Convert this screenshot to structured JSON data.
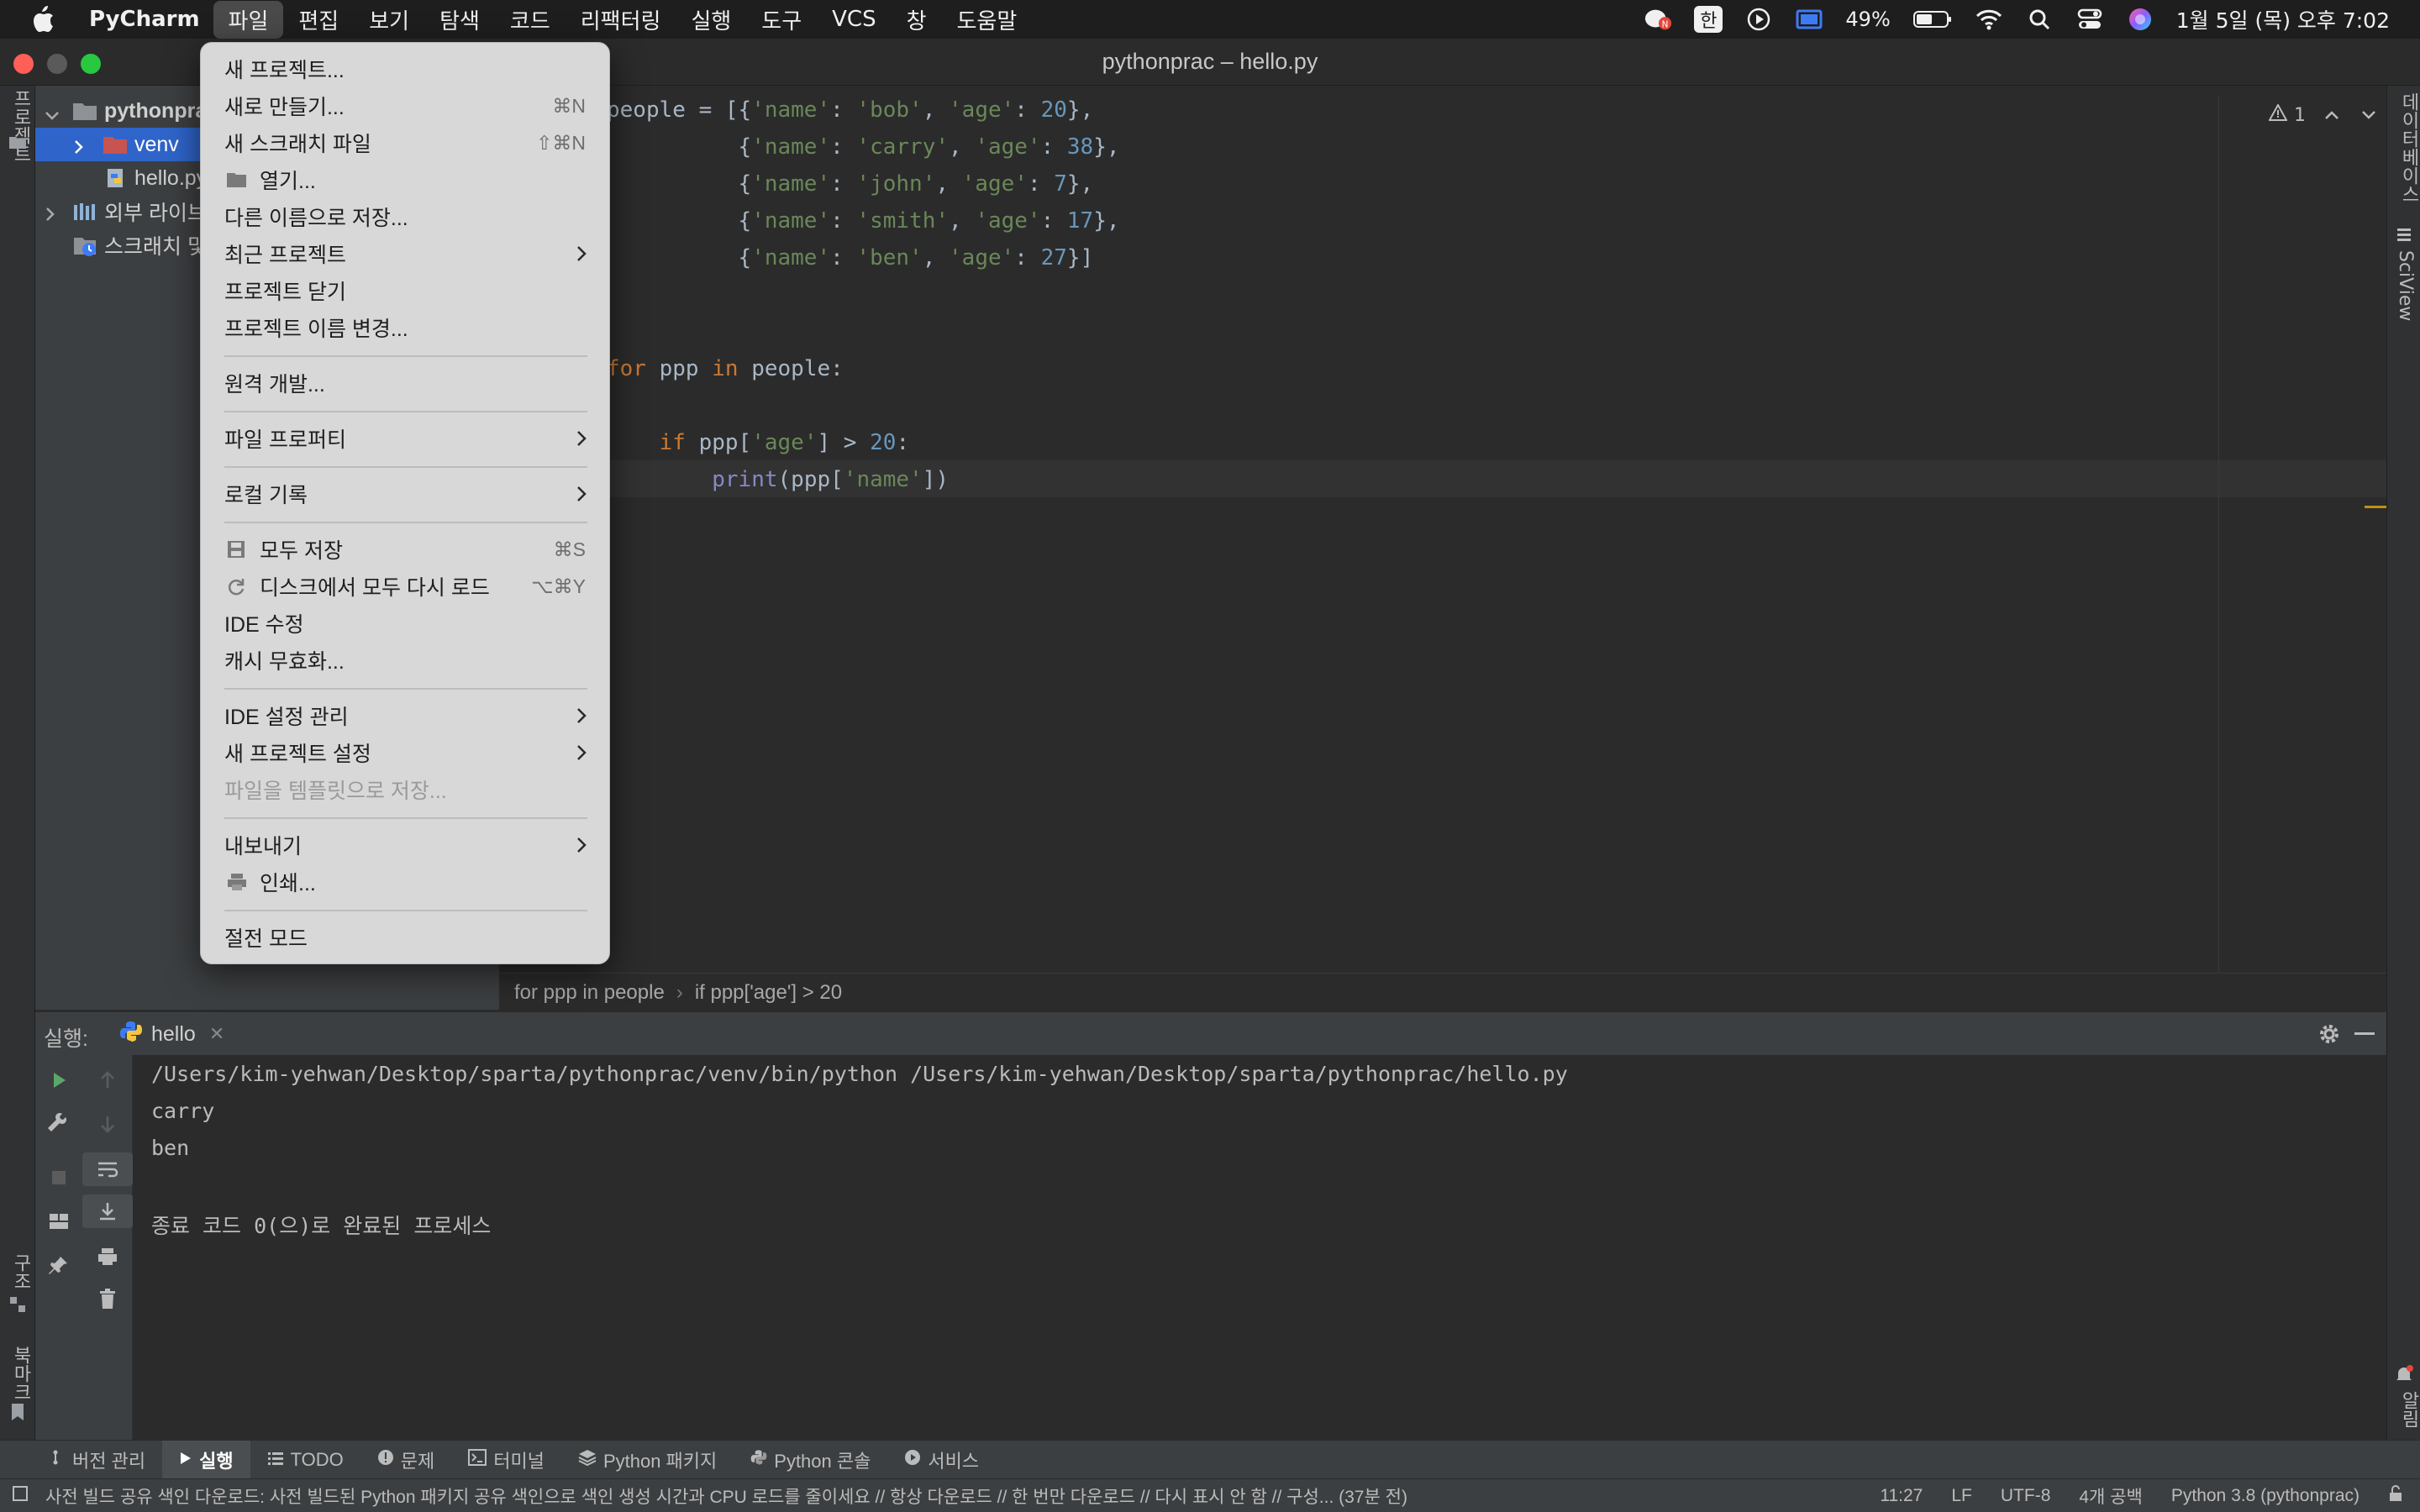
{
  "menubar": {
    "app_name": "PyCharm",
    "items": [
      "파일",
      "편집",
      "보기",
      "탐색",
      "코드",
      "리팩터링",
      "실행",
      "도구",
      "VCS",
      "창",
      "도움말"
    ],
    "active_item": "파일",
    "input_method": "한",
    "battery": "49%",
    "datetime": "1월 5일 (목) 오후 7:02"
  },
  "window": {
    "title": "pythonprac – hello.py"
  },
  "left_strip": {
    "project_label": "프로젝트",
    "structure_label": "구조",
    "bookmarks_label": "북마크"
  },
  "right_strip": {
    "database_label": "데이터베이스",
    "sciview_label": "SciView",
    "notifications_label": "알림"
  },
  "project_tree": {
    "items": [
      {
        "label": "pythonprac",
        "kind": "project-root"
      },
      {
        "label": "venv",
        "kind": "folder",
        "selected": true
      },
      {
        "label": "hello.py",
        "kind": "file"
      },
      {
        "label": "외부 라이브러리",
        "kind": "libraries"
      },
      {
        "label": "스크래치 및 콘솔",
        "kind": "scratches"
      }
    ]
  },
  "editor": {
    "warnings_count": "1",
    "lines": [
      "people = [{'name': 'bob', 'age': 20},",
      "          {'name': 'carry', 'age': 38},",
      "          {'name': 'john', 'age': 7},",
      "          {'name': 'smith', 'age': 17},",
      "          {'name': 'ben', 'age': 27}]",
      "",
      "",
      "for ppp in people:",
      "",
      "    if ppp['age'] > 20:",
      "        print(ppp['name'])"
    ]
  },
  "breadcrumb": {
    "items": [
      "for ppp in people",
      "if ppp['age'] > 20"
    ]
  },
  "file_menu": {
    "items": [
      {
        "label": "새 프로젝트...",
        "shortcut": ""
      },
      {
        "label": "새로 만들기...",
        "shortcut": "⌘N"
      },
      {
        "label": "새 스크래치 파일",
        "shortcut": "⇧⌘N"
      },
      {
        "label": "열기...",
        "shortcut": "",
        "icon": "folder-icon"
      },
      {
        "label": "다른 이름으로 저장...",
        "shortcut": ""
      },
      {
        "label": "최근 프로젝트",
        "submenu": true
      },
      {
        "label": "프로젝트 닫기",
        "shortcut": ""
      },
      {
        "label": "프로젝트 이름 변경...",
        "shortcut": ""
      },
      {
        "label": "원격 개발...",
        "shortcut": ""
      },
      {
        "label": "파일 프로퍼티",
        "submenu": true
      },
      {
        "label": "로컬 기록",
        "submenu": true
      },
      {
        "label": "모두 저장",
        "shortcut": "⌘S",
        "icon": "save-icon"
      },
      {
        "label": "디스크에서 모두 다시 로드",
        "shortcut": "⌥⌘Y",
        "icon": "reload-icon"
      },
      {
        "label": "IDE 수정",
        "shortcut": ""
      },
      {
        "label": "캐시 무효화...",
        "shortcut": ""
      },
      {
        "label": "IDE 설정 관리",
        "submenu": true
      },
      {
        "label": "새 프로젝트 설정",
        "submenu": true
      },
      {
        "label": "파일을 템플릿으로 저장...",
        "disabled": true
      },
      {
        "label": "내보내기",
        "submenu": true
      },
      {
        "label": "인쇄...",
        "shortcut": "",
        "icon": "print-icon"
      },
      {
        "label": "절전 모드",
        "shortcut": ""
      }
    ]
  },
  "run_panel": {
    "title": "실행:",
    "tab": "hello",
    "output": [
      "/Users/kim-yehwan/Desktop/sparta/pythonprac/venv/bin/python /Users/kim-yehwan/Desktop/sparta/pythonprac/hello.py",
      "carry",
      "ben",
      "",
      "종료 코드 0(으)로 완료된 프로세스"
    ]
  },
  "tool_tabs": {
    "items": [
      "버전 관리",
      "실행",
      "TODO",
      "문제",
      "터미널",
      "Python 패키지",
      "Python 콘솔",
      "서비스"
    ],
    "active": "실행"
  },
  "status_bar": {
    "message": "사전 빌드 공유 색인 다운로드: 사전 빌드된 Python 패키지 공유 색인으로 색인 생성 시간과 CPU 로드를 줄이세요 // 항상 다운로드 // 한 번만 다운로드 // 다시 표시 안 함 // 구성... (37분 전)",
    "cursor": "11:27",
    "line_sep": "LF",
    "encoding": "UTF-8",
    "indent": "4개 공백",
    "interpreter": "Python 3.8 (pythonprac)"
  },
  "colors": {
    "editor_bg": "#2b2b2b",
    "panel_bg": "#3c3f41",
    "selection": "#2f65ca",
    "keyword": "#cc7832",
    "string": "#6a8759",
    "number": "#6897bb"
  }
}
